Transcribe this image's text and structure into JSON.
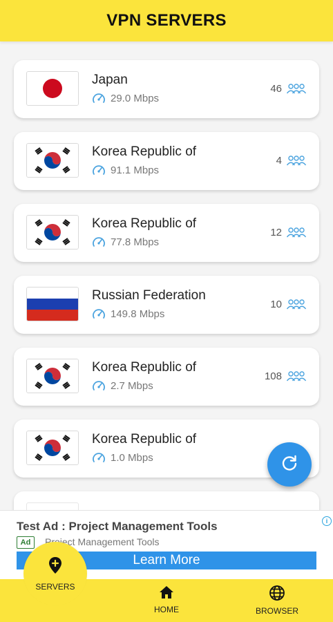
{
  "header": {
    "title": "VPN SERVERS"
  },
  "servers": [
    {
      "country": "Japan",
      "flag": "japan-flag",
      "speed": "29.0 Mbps",
      "users": "46"
    },
    {
      "country": "Korea Republic of",
      "flag": "korea-flag",
      "speed": "91.1 Mbps",
      "users": "4"
    },
    {
      "country": "Korea Republic of",
      "flag": "korea-flag",
      "speed": "77.8 Mbps",
      "users": "12"
    },
    {
      "country": "Russian Federation",
      "flag": "russia-flag",
      "speed": "149.8 Mbps",
      "users": "10"
    },
    {
      "country": "Korea Republic of",
      "flag": "korea-flag",
      "speed": "2.7 Mbps",
      "users": "108"
    },
    {
      "country": "Korea Republic of",
      "flag": "korea-flag",
      "speed": "1.0 Mbps",
      "users": ""
    }
  ],
  "ad": {
    "title": "Test Ad : Project Management Tools",
    "badge": "Ad",
    "subtitle": "Project Management Tools",
    "button_label": "Learn More",
    "info": "i"
  },
  "nav": {
    "servers_label": "SERVERS",
    "home_label": "HOME",
    "browser_label": "BROWSER"
  },
  "colors": {
    "accent_yellow": "#fbe43c",
    "accent_blue": "#2f93e8",
    "icon_blue": "#4aa3df"
  }
}
